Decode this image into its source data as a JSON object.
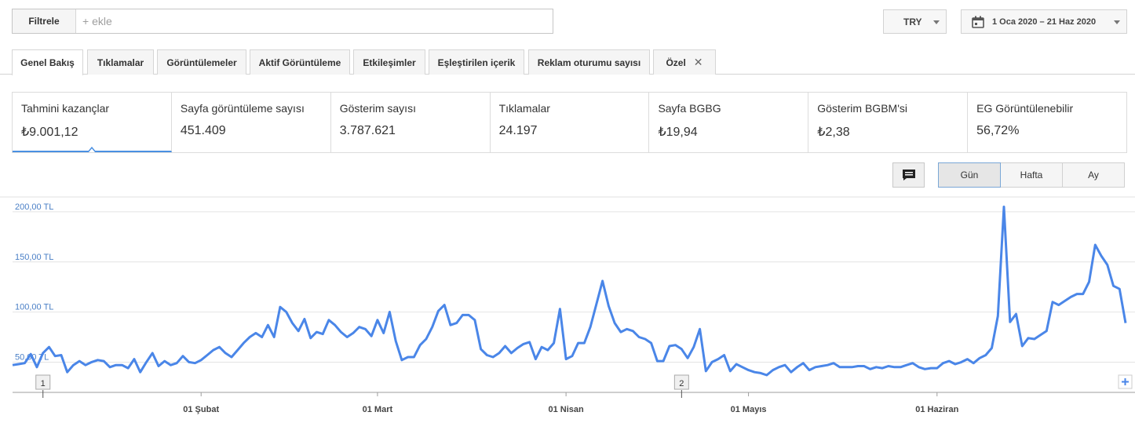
{
  "filter": {
    "button_label": "Filtrele",
    "placeholder": "+ ekle"
  },
  "currency": {
    "label": "TRY"
  },
  "date_range": {
    "label": "1 Oca 2020 – 21 Haz 2020"
  },
  "tabs": [
    {
      "label": "Genel Bakış",
      "active": true
    },
    {
      "label": "Tıklamalar"
    },
    {
      "label": "Görüntülemeler"
    },
    {
      "label": "Aktif Görüntüleme"
    },
    {
      "label": "Etkileşimler"
    },
    {
      "label": "Eşleştirilen içerik"
    },
    {
      "label": "Reklam oturumu sayısı"
    },
    {
      "label": "Özel",
      "closable": true
    }
  ],
  "metrics": [
    {
      "label": "Tahmini kazançlar",
      "value": "₺9.001,12",
      "active": true
    },
    {
      "label": "Sayfa görüntüleme sayısı",
      "value": "451.409"
    },
    {
      "label": "Gösterim sayısı",
      "value": "3.787.621"
    },
    {
      "label": "Tıklamalar",
      "value": "24.197"
    },
    {
      "label": "Sayfa BGBG",
      "value": "₺19,94"
    },
    {
      "label": "Gösterim BGBM'si",
      "value": "₺2,38"
    },
    {
      "label": "EG Görüntülenebilir",
      "value": "56,72%"
    }
  ],
  "annotation_button": {
    "icon": "comment-icon"
  },
  "granularity": {
    "options": [
      "Gün",
      "Hafta",
      "Ay"
    ],
    "selected": "Gün"
  },
  "colors": {
    "series": "#4a86e8",
    "axis_label": "#4a7fc6",
    "active_tab_underline": "#4a90e2"
  },
  "chart_data": {
    "type": "line",
    "y_tick_labels": [
      "200,00 TL",
      "150,00 TL",
      "100,00 TL",
      "50,00 TL"
    ],
    "y_tick_values": [
      200,
      150,
      100,
      50
    ],
    "ylim": [
      30,
      205
    ],
    "grid": true,
    "x_tick_labels": [
      "01 Şubat",
      "01 Mart",
      "01 Nisan",
      "01 Mayıs",
      "01 Haziran"
    ],
    "x_tick_days": [
      31,
      60,
      91,
      121,
      152
    ],
    "annotation_markers": [
      {
        "label": "1",
        "day": 5
      },
      {
        "label": "2",
        "day": 110
      }
    ],
    "x_range": [
      "2020-01-01",
      "2020-06-21"
    ],
    "series": [
      {
        "values": [
          40,
          41,
          42,
          51,
          38,
          52,
          58,
          49,
          50,
          33,
          40,
          44,
          40,
          43,
          45,
          44,
          38,
          40,
          40,
          37,
          46,
          33,
          43,
          52,
          39,
          44,
          40,
          42,
          49,
          43,
          42,
          45,
          50,
          55,
          58,
          52,
          48,
          55,
          62,
          68,
          72,
          68,
          80,
          68,
          98,
          93,
          82,
          74,
          86,
          67,
          73,
          71,
          85,
          80,
          73,
          68,
          72,
          78,
          76,
          69,
          85,
          72,
          93,
          64,
          45,
          48,
          48,
          60,
          66,
          78,
          94,
          100,
          80,
          82,
          90,
          90,
          85,
          56,
          50,
          48,
          52,
          59,
          52,
          57,
          61,
          63,
          46,
          58,
          55,
          62,
          96,
          46,
          49,
          62,
          62,
          78,
          101,
          124,
          99,
          82,
          73,
          76,
          74,
          68,
          66,
          62,
          44,
          44,
          59,
          60,
          56,
          47,
          58,
          76,
          34,
          43,
          46,
          50,
          34,
          41,
          38,
          35,
          33,
          32,
          30,
          35,
          38,
          40,
          33,
          38,
          42,
          35,
          38,
          39,
          40,
          42,
          38,
          38,
          38,
          39,
          39,
          36,
          38,
          37,
          39,
          38,
          38,
          40,
          42,
          38,
          36,
          37,
          37,
          42,
          44,
          41,
          43,
          46,
          42,
          47,
          50,
          57,
          89,
          198,
          83,
          91,
          59,
          67,
          66,
          70,
          74,
          103,
          100,
          104,
          108,
          111,
          111,
          123,
          160,
          149,
          140,
          119,
          116,
          82
        ]
      }
    ]
  }
}
